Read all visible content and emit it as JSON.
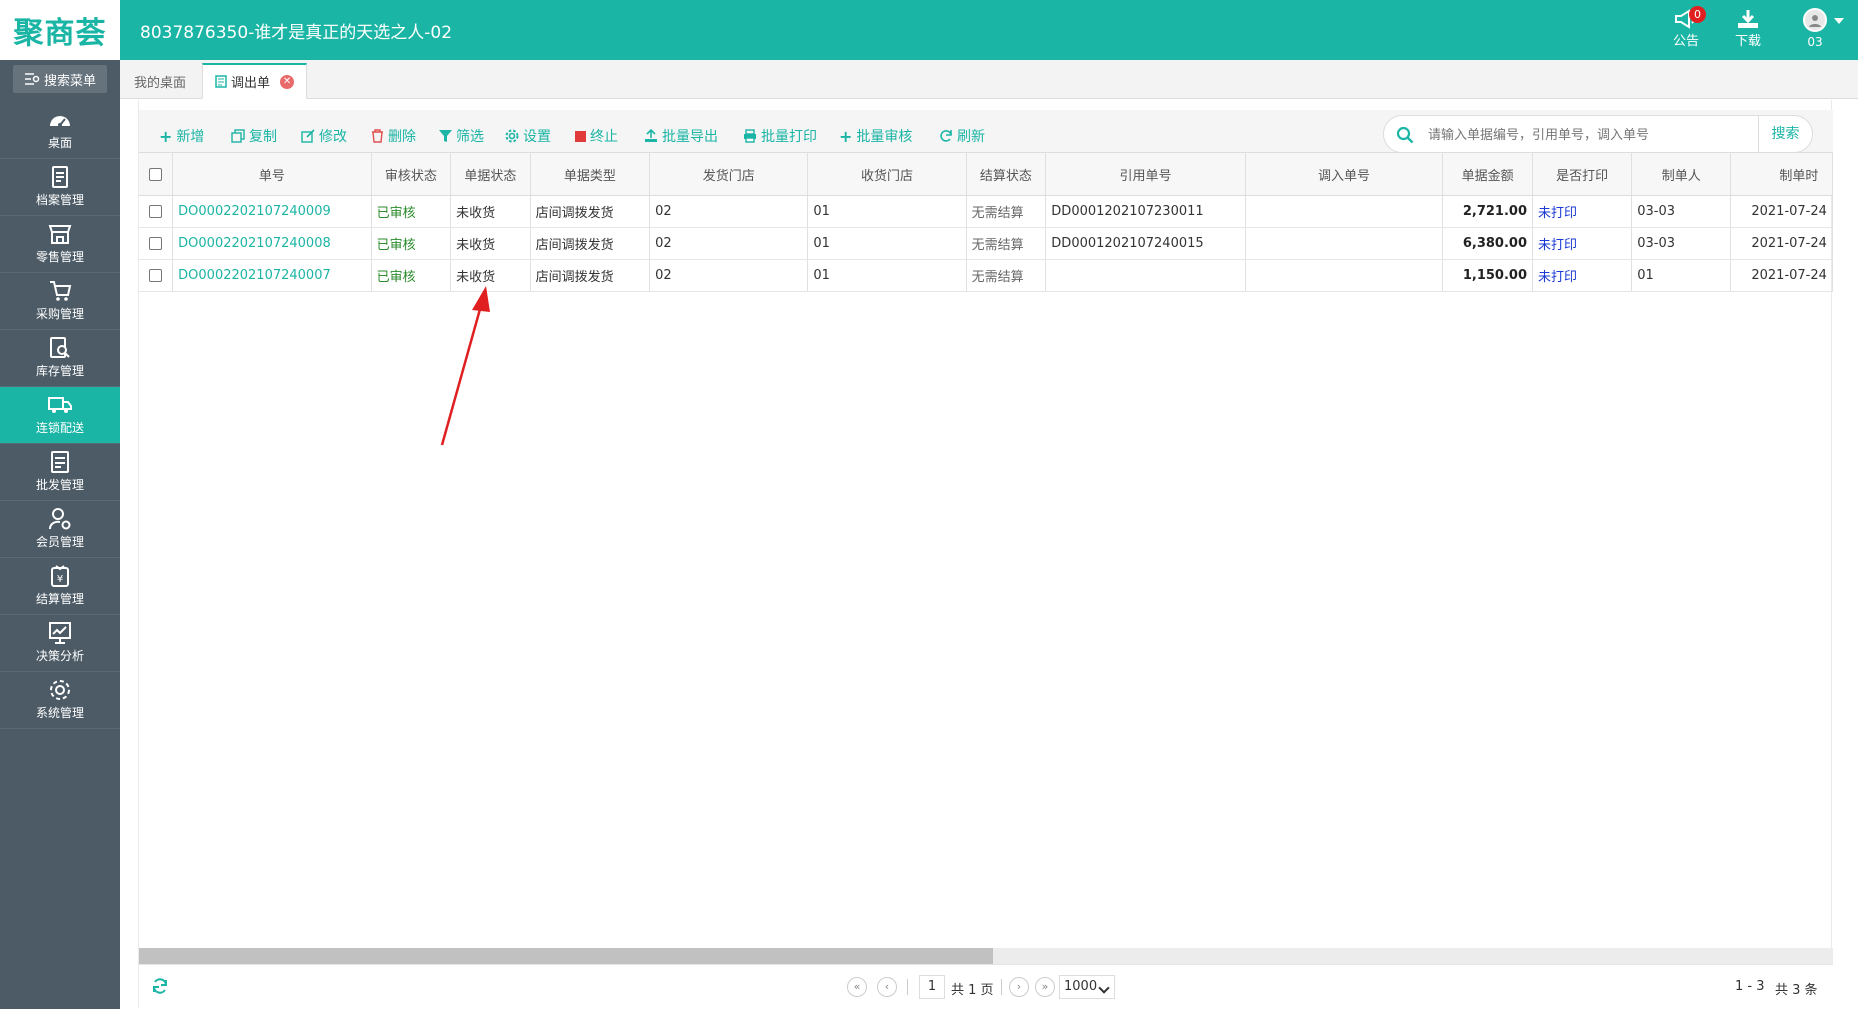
{
  "app": {
    "logo": "聚商荟",
    "title": "8037876350-谁才是真正的天选之人-02",
    "announce_label": "公告",
    "announce_badge": "0",
    "download_label": "下载",
    "user_label": "03"
  },
  "sidebar": {
    "search_label": "搜索菜单",
    "items": [
      {
        "label": "桌面",
        "icon": "dashboard-icon"
      },
      {
        "label": "档案管理",
        "icon": "archive-icon"
      },
      {
        "label": "零售管理",
        "icon": "store-icon"
      },
      {
        "label": "采购管理",
        "icon": "cart-icon"
      },
      {
        "label": "库存管理",
        "icon": "inventory-search-icon"
      },
      {
        "label": "连锁配送",
        "icon": "truck-icon",
        "active": true
      },
      {
        "label": "批发管理",
        "icon": "wholesale-icon"
      },
      {
        "label": "会员管理",
        "icon": "member-icon"
      },
      {
        "label": "结算管理",
        "icon": "settlement-icon"
      },
      {
        "label": "决策分析",
        "icon": "analysis-chart-icon"
      },
      {
        "label": "系统管理",
        "icon": "gear-icon"
      }
    ]
  },
  "tabs": {
    "home": "我的桌面",
    "current": "调出单"
  },
  "toolbar": {
    "add": "新增",
    "copy": "复制",
    "edit": "修改",
    "delete": "删除",
    "filter": "筛选",
    "settings": "设置",
    "terminate": "终止",
    "batch_export": "批量导出",
    "batch_print": "批量打印",
    "batch_audit": "批量审核",
    "refresh": "刷新",
    "search_placeholder": "请输入单据编号，引用单号，调入单号",
    "search_button": "搜索"
  },
  "table": {
    "headers": [
      "单号",
      "审核状态",
      "单据状态",
      "单据类型",
      "发货门店",
      "收货门店",
      "结算状态",
      "引用单号",
      "调入单号",
      "单据金额",
      "是否打印",
      "制单人",
      "制单时"
    ],
    "rows": [
      [
        "DO0002202107240009",
        "已审核",
        "未收货",
        "店间调拨发货",
        "02",
        "01",
        "无需结算",
        "DD0001202107230011",
        "",
        "2,721.00",
        "未打印",
        "03-03",
        "2021-07-24"
      ],
      [
        "DO0002202107240008",
        "已审核",
        "未收货",
        "店间调拨发货",
        "02",
        "01",
        "无需结算",
        "DD0001202107240015",
        "",
        "6,380.00",
        "未打印",
        "03-03",
        "2021-07-24"
      ],
      [
        "DO0002202107240007",
        "已审核",
        "未收货",
        "店间调拨发货",
        "02",
        "01",
        "无需结算",
        "",
        "",
        "1,150.00",
        "未打印",
        "01",
        "2021-07-24"
      ]
    ]
  },
  "pager": {
    "page": "1",
    "total_pages": "共 1 页",
    "page_size": "1000",
    "range": "1 - 3",
    "count": "共 3 条"
  },
  "colors": {
    "accent": "#1bb5a5",
    "sidebar": "#4c5b66",
    "annotation": "#e02020"
  }
}
